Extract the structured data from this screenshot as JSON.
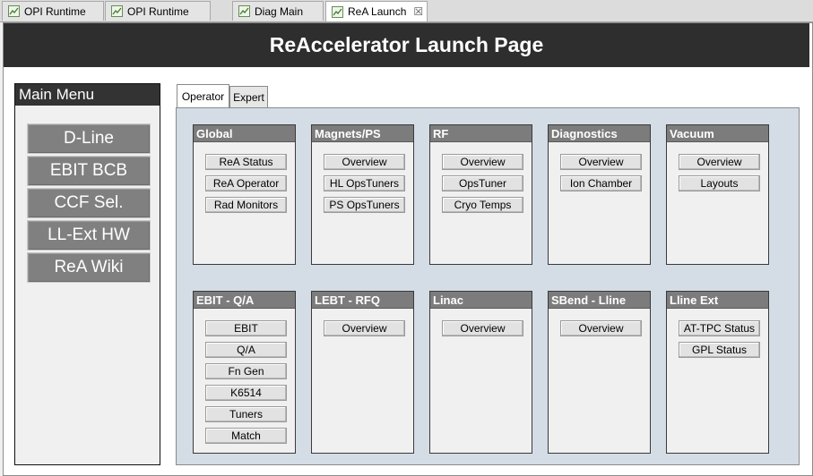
{
  "editor_tabs": [
    {
      "label": "OPI Runtime"
    },
    {
      "label": "OPI Runtime"
    },
    {
      "label": "Diag Main"
    },
    {
      "label": "ReA Launch",
      "close_glyph": "☒"
    }
  ],
  "banner": {
    "title": "ReAccelerator Launch Page"
  },
  "main_menu": {
    "title": "Main Menu",
    "items": [
      {
        "label": "D-Line"
      },
      {
        "label": "EBIT BCB"
      },
      {
        "label": "CCF Sel."
      },
      {
        "label": "LL-Ext HW"
      },
      {
        "label": "ReA Wiki"
      }
    ]
  },
  "folder_tabs": [
    {
      "label": "Operator",
      "active": true
    },
    {
      "label": "Expert",
      "active": false
    }
  ],
  "groups": [
    {
      "title": "Global",
      "buttons": [
        "ReA Status",
        "ReA Operator",
        "Rad Monitors"
      ]
    },
    {
      "title": "Magnets/PS",
      "buttons": [
        "Overview",
        "HL OpsTuners",
        "PS OpsTuners"
      ]
    },
    {
      "title": "RF",
      "buttons": [
        "Overview",
        "OpsTuner",
        "Cryo Temps"
      ]
    },
    {
      "title": "Diagnostics",
      "buttons": [
        "Overview",
        "Ion Chamber"
      ]
    },
    {
      "title": "Vacuum",
      "buttons": [
        "Overview",
        "Layouts"
      ]
    },
    {
      "title": "EBIT - Q/A",
      "buttons": [
        "EBIT",
        "Q/A",
        "Fn Gen",
        "K6514",
        "Tuners",
        "Match"
      ]
    },
    {
      "title": "LEBT - RFQ",
      "buttons": [
        "Overview"
      ]
    },
    {
      "title": "Linac",
      "buttons": [
        "Overview"
      ]
    },
    {
      "title": "SBend - Lline",
      "buttons": [
        "Overview"
      ]
    },
    {
      "title": "Lline Ext",
      "buttons": [
        "AT-TPC Status",
        "GPL Status"
      ]
    }
  ],
  "colors": {
    "banner_bg": "#2e2e2e",
    "menu_button_bg": "#808080",
    "folder_bg": "#d4dde6",
    "group_title_bg": "#7c7c7c"
  },
  "icons": {
    "editor_tab": "opi-display-icon"
  }
}
